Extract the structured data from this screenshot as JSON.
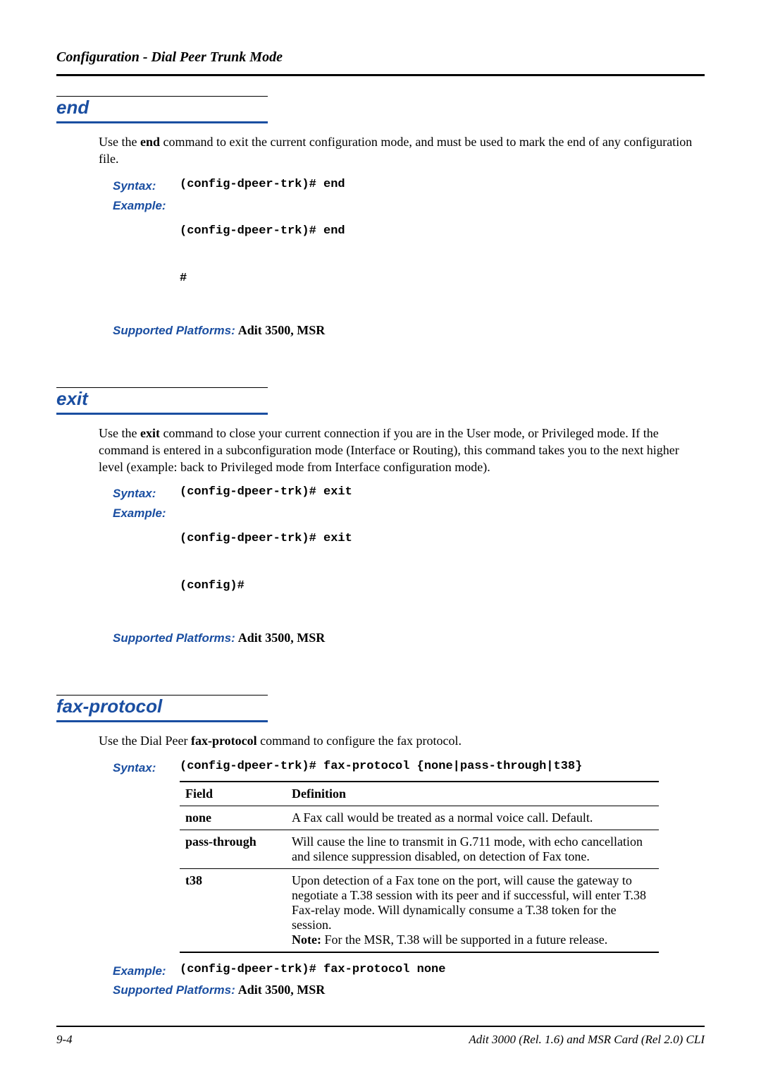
{
  "header": {
    "running_title": "Configuration - Dial Peer Trunk Mode"
  },
  "sections": {
    "end": {
      "title": "end",
      "desc_pre": "Use the ",
      "desc_bold": "end",
      "desc_post": " command to exit the current configuration mode, and must be used to mark the end of any configuration file.",
      "syntax_label": "Syntax:",
      "syntax_code": "(config-dpeer-trk)# end",
      "example_label": "Example:",
      "example_code1": "(config-dpeer-trk)# end",
      "example_code2": "#",
      "platforms_label": "Supported Platforms:",
      "platforms_value": "  Adit 3500, MSR"
    },
    "exit": {
      "title": "exit",
      "desc_pre": "Use the ",
      "desc_bold": "exit",
      "desc_post": " command to close your current connection if you are in the User mode, or Privileged mode. If the command is entered in a subconfiguration mode (Interface or Routing), this command takes you to the next higher level (example: back to Privileged mode from Interface configuration mode).",
      "syntax_label": "Syntax:",
      "syntax_code": "(config-dpeer-trk)# exit",
      "example_label": "Example:",
      "example_code1": "(config-dpeer-trk)# exit",
      "example_code2": "(config)#",
      "platforms_label": "Supported Platforms:",
      "platforms_value": "  Adit 3500, MSR"
    },
    "fax": {
      "title": "fax-protocol",
      "desc_pre": "Use the Dial Peer ",
      "desc_bold": "fax-protocol",
      "desc_post": " command to configure the fax protocol.",
      "syntax_label": "Syntax:",
      "syntax_code": "(config-dpeer-trk)# fax-protocol {none|pass-through|t38}",
      "table": {
        "head_field": "Field",
        "head_def": "Definition",
        "rows": [
          {
            "field": "none",
            "def": "A Fax call would be treated as a normal voice call. Default."
          },
          {
            "field": "pass-through",
            "def": "Will cause the line to transmit in G.711 mode, with echo cancellation and silence suppression disabled, on detection of Fax tone."
          },
          {
            "field": "t38",
            "def_main": "Upon detection of a Fax tone on the port, will cause the gateway to negotiate a T.38 session with its peer and if successful, will enter T.38 Fax-relay mode. Will dynamically consume a T.38 token for the session.",
            "note_label": "Note:",
            "note_text": "  For the MSR, T.38 will be supported in a future release."
          }
        ]
      },
      "example_label": "Example:",
      "example_code": "(config-dpeer-trk)# fax-protocol none",
      "platforms_label": "Supported Platforms:",
      "platforms_value": "  Adit 3500, MSR"
    }
  },
  "footer": {
    "page_num": "9-4",
    "doc_title": "Adit 3000 (Rel. 1.6) and MSR Card (Rel 2.0) CLI"
  }
}
